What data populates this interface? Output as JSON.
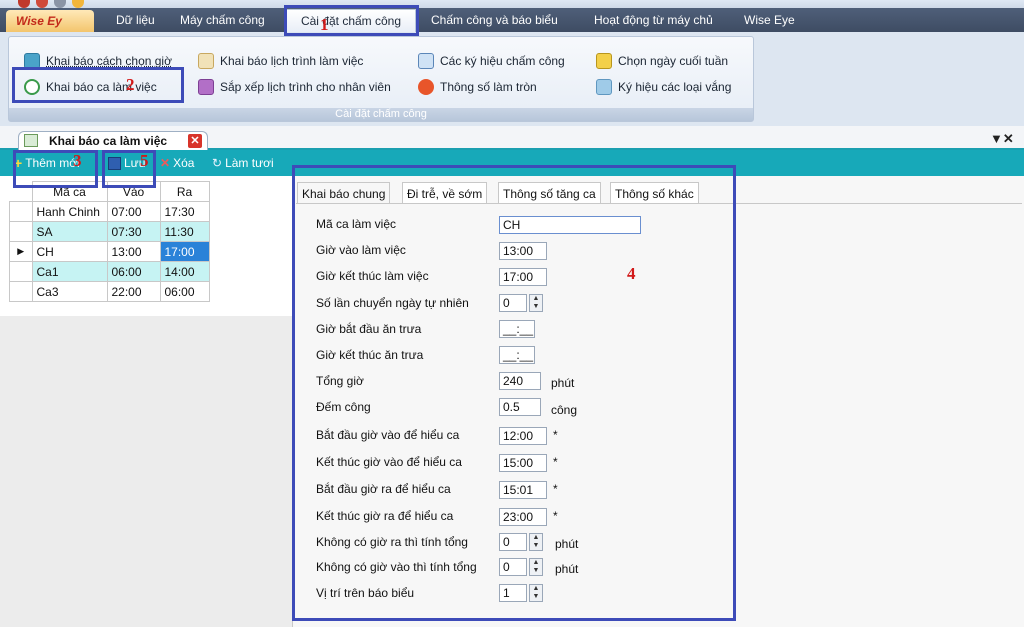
{
  "app": {
    "logo_text": "Wise Ey"
  },
  "menu": {
    "items": [
      "Dữ liệu",
      "Máy chấm công",
      "Cài đặt chấm công",
      "Chấm công và báo biểu",
      "Hoạt động từ máy chủ",
      "Wise Eye"
    ],
    "active_index": 2
  },
  "ribbon": {
    "group_caption": "Cài đặt chấm công",
    "buttons": [
      "Khai báo cách chọn giờ",
      "Khai báo ca làm việc",
      "Khai báo lịch trình làm việc",
      "Sắp xếp lịch trình cho nhân viên",
      "Các ký hiệu chấm công",
      "Thông số làm tròn",
      "Chọn ngày cuối tuần",
      "Ký hiệu các loại vắng"
    ]
  },
  "doc_tab": {
    "title": "Khai báo ca làm việc",
    "close_glyph": "✕",
    "pin_glyph": "▼✕"
  },
  "toolbar": {
    "add": "Thêm mới",
    "save": "Lưu",
    "delete": "Xóa",
    "refresh": "Làm tươi"
  },
  "grid": {
    "headers": [
      "Mã ca",
      "Vào",
      "Ra"
    ],
    "current_marker": "▶",
    "rows": [
      [
        "Hanh Chinh",
        "07:00",
        "17:30"
      ],
      [
        "SA",
        "07:30",
        "11:30"
      ],
      [
        "CH",
        "13:00",
        "17:00"
      ],
      [
        "Ca1",
        "06:00",
        "14:00"
      ],
      [
        "Ca3",
        "22:00",
        "06:00"
      ]
    ]
  },
  "form_tabs": [
    "Khai báo chung",
    "Đi trễ, về sớm",
    "Thông số tăng ca",
    "Thông số khác"
  ],
  "form": {
    "labels": [
      "Mã ca làm việc",
      "Giờ vào làm việc",
      "Giờ kết thúc làm việc",
      "Số lần chuyển ngày tự nhiên",
      "Giờ bắt đầu ăn trưa",
      "Giờ kết thúc ăn trưa",
      "Tổng giờ",
      "Đếm công",
      "Bắt đầu giờ vào để hiểu ca",
      "Kết thúc giờ vào để hiểu ca",
      "Bắt đầu giờ ra để hiểu ca",
      "Kết thúc giờ ra để hiểu ca",
      "Không có giờ ra thì tính tổng",
      "Không có giờ vào thì tính tổng",
      "Vị trí trên báo biểu"
    ],
    "values": [
      "CH",
      "13:00",
      "17:00",
      "0",
      "__:__",
      "__:__",
      "240",
      "0.5",
      "12:00",
      "15:00",
      "15:01",
      "23:00",
      "0",
      "0",
      "1"
    ],
    "units": {
      "total_hours": "phút",
      "count": "công",
      "star": "*",
      "no_out": "phút",
      "no_in": "phút"
    }
  },
  "annotations": [
    "1",
    "2",
    "3",
    "4",
    "5"
  ],
  "colors": {
    "annotation_box": "#3d4bb8",
    "annotation_number": "#d21a1a",
    "toolbar": "#17a9b9",
    "grid_alt": "#c6f3f3",
    "selection": "#2a82d8"
  }
}
